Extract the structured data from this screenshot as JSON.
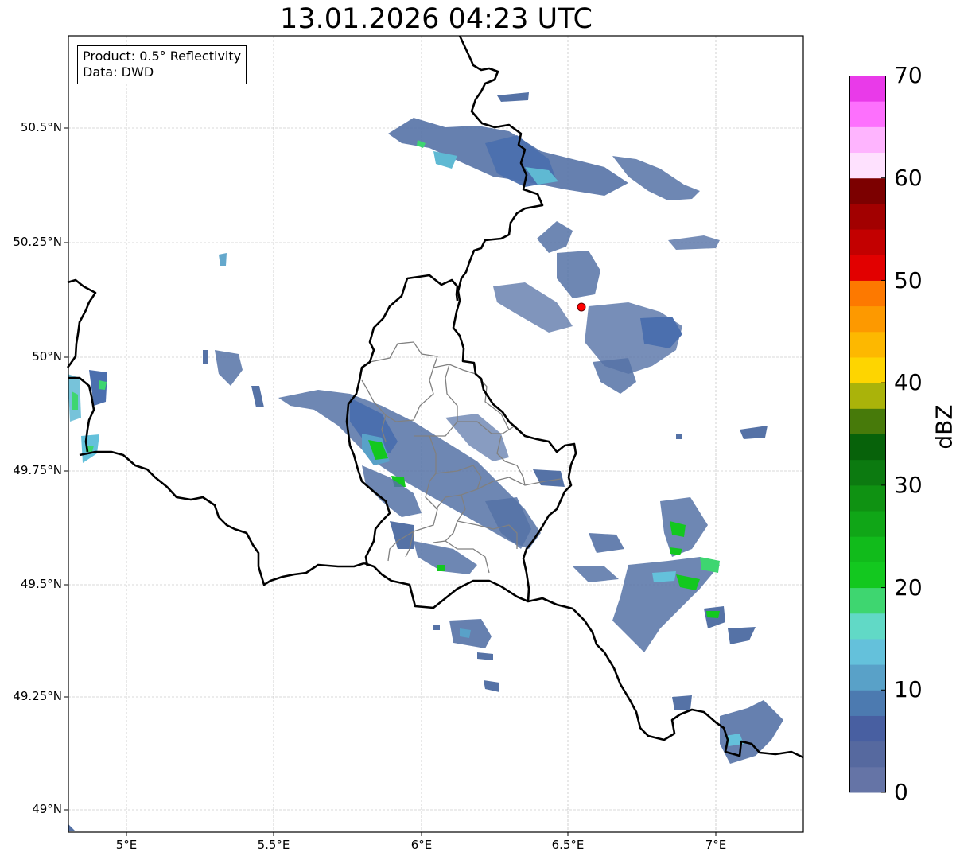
{
  "title": "13.01.2026 04:23 UTC",
  "info": {
    "product": "Product: 0.5° Reflectivity",
    "data": "Data: DWD"
  },
  "map": {
    "lon_range": [
      4.8,
      7.3
    ],
    "lat_range": [
      48.95,
      50.7
    ],
    "lat_ticks": [
      "50.5°N",
      "50.25°N",
      "50°N",
      "49.75°N",
      "49.5°N",
      "49.25°N",
      "49°N"
    ],
    "lon_ticks": [
      "5°E",
      "5.5°E",
      "6°E",
      "6.5°E",
      "7°E"
    ],
    "grid": true,
    "border_color": "#000000",
    "admin_border_color": "#808080",
    "radar_site_color": "#ff0000"
  },
  "colorbar": {
    "label": "dBZ",
    "ticks": [
      "0",
      "10",
      "20",
      "30",
      "40",
      "50",
      "60",
      "70"
    ],
    "min": 0,
    "max": 70,
    "colors": [
      "#6574a6",
      "#56699f",
      "#485fa1",
      "#4c7ab0",
      "#59a1c8",
      "#64c1db",
      "#61d9c6",
      "#3ed670",
      "#13c81f",
      "#11bb1b",
      "#10a617",
      "#0f9212",
      "#0c7a10",
      "#07620a",
      "#477a0a",
      "#aab30a",
      "#fed500",
      "#fdb800",
      "#fd9900",
      "#fd7900",
      "#e20000",
      "#c30000",
      "#a20000",
      "#7c0000",
      "#fee1fe",
      "#feb4fe",
      "#fd70fd",
      "#e93ae9"
    ]
  }
}
